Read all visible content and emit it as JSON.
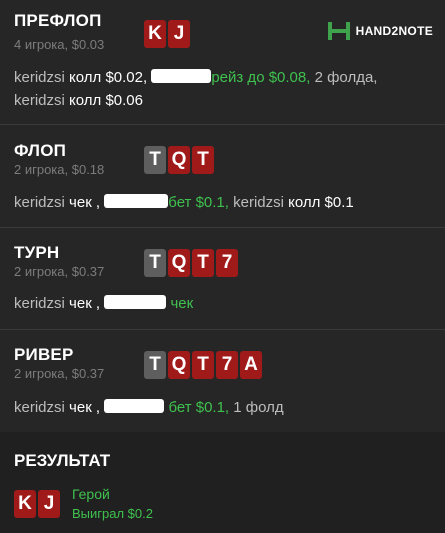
{
  "brand": {
    "logo_text": "HAND2NOTE"
  },
  "streets": [
    {
      "title": "ПРЕФЛОП",
      "subtitle": "4 игрока, $0.03",
      "cards": [
        "K",
        "J"
      ],
      "line1": {
        "p1": "keridzsi",
        "a1": "колл $0.02,",
        "hero_action": "рейз до $0.08,",
        "rest": "2 фолда,"
      },
      "line2": {
        "p1": "keridzsi",
        "a1": "колл $0.06"
      }
    },
    {
      "title": "ФЛОП",
      "subtitle": "2 игрока, $0.18",
      "cards": [
        "T",
        "Q",
        "T"
      ],
      "line1": {
        "p1": "keridzsi",
        "a1": "чек ,",
        "hero_action": "бет $0.1,",
        "p2": "keridzsi",
        "a2": "колл $0.1"
      }
    },
    {
      "title": "ТУРН",
      "subtitle": "2 игрока, $0.37",
      "cards": [
        "T",
        "Q",
        "T",
        "7"
      ],
      "line1": {
        "p1": "keridzsi",
        "a1": "чек ,",
        "hero_action": "чек"
      }
    },
    {
      "title": "РИВЕР",
      "subtitle": "2 игрока, $0.37",
      "cards": [
        "T",
        "Q",
        "T",
        "7",
        "A"
      ],
      "line1": {
        "p1": "keridzsi",
        "a1": "чек ,",
        "hero_action": "бет $0.1,",
        "rest": "1 фолд"
      }
    }
  ],
  "result": {
    "title": "РЕЗУЛЬТАТ",
    "cards": [
      "K",
      "J"
    ],
    "hero_label": "Герой",
    "won_text": "Выиграл $0.2"
  },
  "colors": {
    "background": "#262626",
    "red_card": "#a01a1a",
    "gray_card": "#5e5e5e",
    "hero_green": "#3fc14f",
    "logo_green": "#3fa34d"
  }
}
